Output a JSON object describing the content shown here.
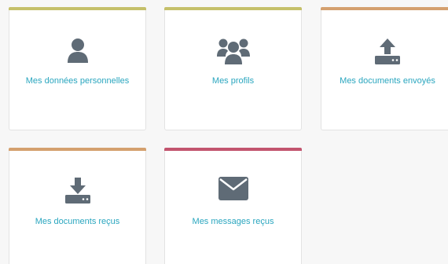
{
  "tiles": [
    {
      "label": "Mes données personnelles",
      "icon": "user-icon",
      "accent": "#c5c06a"
    },
    {
      "label": "Mes profils",
      "icon": "users-icon",
      "accent": "#c5c06a"
    },
    {
      "label": "Mes documents envoyés",
      "icon": "upload-icon",
      "accent": "#d4a06e"
    },
    {
      "label": "Mes documents reçus",
      "icon": "download-icon",
      "accent": "#d4a06e"
    },
    {
      "label": "Mes messages reçus",
      "icon": "envelope-icon",
      "accent": "#c2546e"
    }
  ],
  "colors": {
    "icon": "#5f6b76",
    "link": "#2aa6bf",
    "background": "#f7f7f7"
  }
}
